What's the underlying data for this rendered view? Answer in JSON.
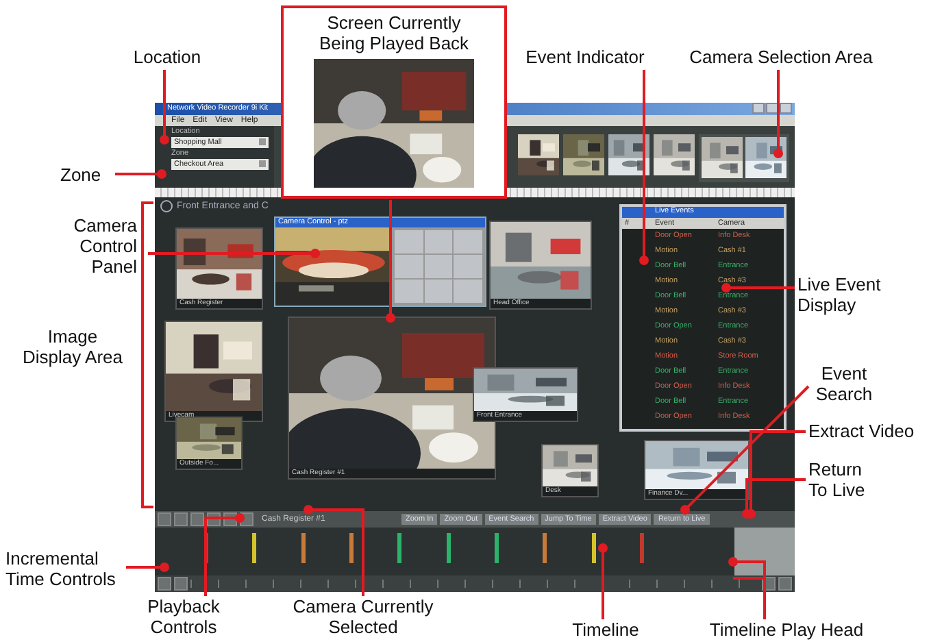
{
  "popup_callout": {
    "text": "Screen Currently\nBeing Played Back"
  },
  "window": {
    "title": "Network Video Recorder 9i Kit"
  },
  "menu": [
    "File",
    "Edit",
    "View",
    "Help"
  ],
  "location": {
    "label": "Location",
    "value": "Shopping Mall"
  },
  "zone": {
    "label": "Zone",
    "value": "Checkout Area"
  },
  "view_title": "Front Entrance and C",
  "tiles": [
    {
      "label": "Cash Register"
    },
    {
      "label": "Head Office"
    },
    {
      "label": "Cash Register #1"
    },
    {
      "label": "Livecam"
    },
    {
      "label": "Outside Fo..."
    },
    {
      "label": "Front Entrance"
    },
    {
      "label": "Desk"
    },
    {
      "label": "Finance Dv..."
    }
  ],
  "camera_control": {
    "title": "Camera Control - ptz"
  },
  "live_events": {
    "title": "Live Events",
    "columns": [
      "#",
      "Event",
      "Camera"
    ],
    "rows": [
      {
        "event": "Door Open",
        "camera": "Info Desk",
        "color": "#d0604c"
      },
      {
        "event": "Motion",
        "camera": "Cash #1",
        "color": "#c8a060"
      },
      {
        "event": "Door Bell",
        "camera": "Entrance",
        "color": "#3bb26a"
      },
      {
        "event": "Motion",
        "camera": "Cash #3",
        "color": "#c8a060"
      },
      {
        "event": "Door Bell",
        "camera": "Entrance",
        "color": "#3bb26a"
      },
      {
        "event": "Motion",
        "camera": "Cash #3",
        "color": "#c8a060"
      },
      {
        "event": "Door Open",
        "camera": "Entrance",
        "color": "#3bb26a"
      },
      {
        "event": "Motion",
        "camera": "Cash #3",
        "color": "#c8a060"
      },
      {
        "event": "Motion",
        "camera": "Store Room",
        "color": "#d0604c"
      },
      {
        "event": "Door Bell",
        "camera": "Entrance",
        "color": "#3bb26a"
      },
      {
        "event": "Door Open",
        "camera": "Info Desk",
        "color": "#d0604c"
      },
      {
        "event": "Door Bell",
        "camera": "Entrance",
        "color": "#3bb26a"
      },
      {
        "event": "Door Open",
        "camera": "Info Desk",
        "color": "#d0604c"
      }
    ]
  },
  "toolbar": {
    "selected_camera": "Cash Register #1",
    "buttons": [
      "Zoom In",
      "Zoom Out",
      "Event Search",
      "Jump To Time",
      "Extract Video",
      "Return to Live"
    ]
  },
  "timeline": {
    "markers": [
      {
        "color": "#c0392b"
      },
      {
        "color": "#d4c22c"
      },
      {
        "color": "#c87a3a"
      },
      {
        "color": "#c87a3a"
      },
      {
        "color": "#2bb36a"
      },
      {
        "color": "#2bb36a"
      },
      {
        "color": "#2bb36a"
      },
      {
        "color": "#c87a3a"
      },
      {
        "color": "#d4c22c"
      },
      {
        "color": "#c0392b"
      }
    ]
  },
  "callouts": [
    {
      "text": "Location"
    },
    {
      "text": "Event Indicator"
    },
    {
      "text": "Camera Selection Area"
    },
    {
      "text": "Zone"
    },
    {
      "text": "Camera\nControl\nPanel"
    },
    {
      "text": "Image\nDisplay Area"
    },
    {
      "text": "Live Event\nDisplay"
    },
    {
      "text": "Event\nSearch"
    },
    {
      "text": "Extract Video"
    },
    {
      "text": "Return\nTo Live"
    },
    {
      "text": "Incremental\nTime Controls"
    },
    {
      "text": "Playback\nControls"
    },
    {
      "text": "Camera Currently\nSelected"
    },
    {
      "text": "Timeline"
    },
    {
      "text": "Timeline Play Head"
    }
  ]
}
